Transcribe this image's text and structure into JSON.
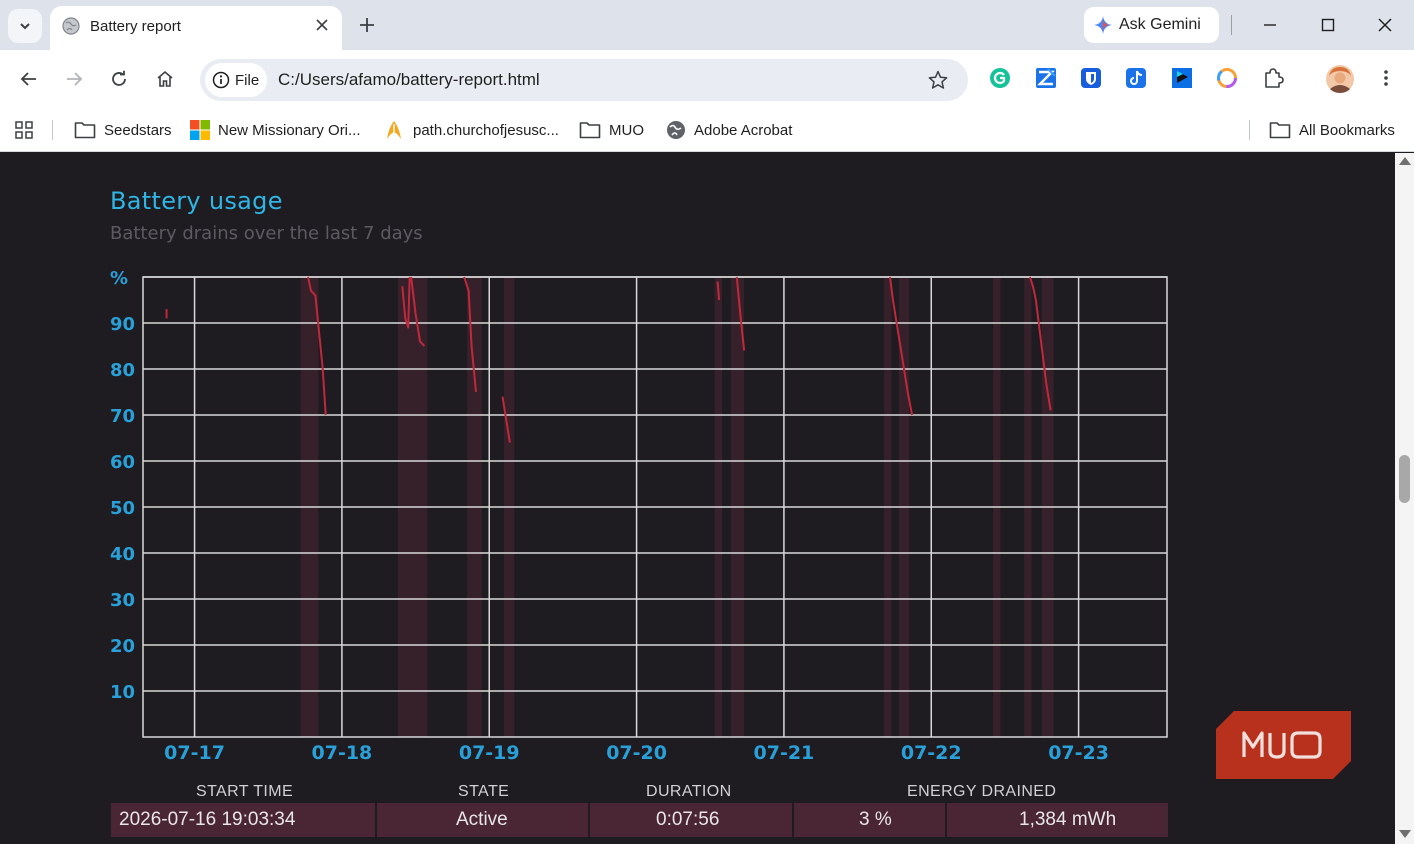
{
  "browser": {
    "tab": {
      "title": "Battery report",
      "favicon": "globe-icon"
    },
    "gemini_label": "Ask Gemini",
    "omnibox": {
      "chip_label": "File",
      "url": "C:/Users/afamo/battery-report.html"
    },
    "extensions": [
      "grammarly-icon",
      "zotero-icon",
      "bitwarden-icon",
      "tiktok-icon",
      "flag-extension-icon",
      "copilot-icon",
      "puzzle-icon"
    ],
    "bookmarks": [
      {
        "label": "Seedstars",
        "icon": "folder-icon"
      },
      {
        "label": "New Missionary Ori...",
        "icon": "windows-logo-icon"
      },
      {
        "label": "path.churchofjesusc...",
        "icon": "churchofjesus-icon"
      },
      {
        "label": "MUO",
        "icon": "folder-icon"
      },
      {
        "label": "Adobe Acrobat",
        "icon": "globe-icon"
      }
    ],
    "all_bookmarks_label": "All Bookmarks"
  },
  "report": {
    "title": "Battery usage",
    "subtitle": "Battery drains over the last 7 days",
    "table": {
      "headers": [
        "START TIME",
        "STATE",
        "DURATION",
        "ENERGY DRAINED"
      ],
      "rows": [
        {
          "start_time": "2026-07-16  19:03:34",
          "state": "Active",
          "duration": "0:07:56",
          "energy_percent": "3 %",
          "energy_mwh": "1,384 mWh"
        }
      ]
    }
  },
  "chart_data": {
    "type": "line",
    "title": "",
    "ylabel": "%",
    "yticks": [
      "90",
      "80",
      "70",
      "60",
      "50",
      "40",
      "30",
      "20",
      "10"
    ],
    "ylim": [
      0,
      100
    ],
    "xlim": [
      16.65,
      23.6
    ],
    "xticks": [
      "07-17",
      "07-18",
      "07-19",
      "07-20",
      "07-21",
      "07-22",
      "07-23"
    ],
    "xtick_values": [
      17,
      18,
      19,
      20,
      21,
      22,
      23
    ],
    "grid": true,
    "line_color": "#c1283c",
    "activity_color": "#4a2533",
    "series": [
      {
        "x": [
          16.81,
          16.81
        ],
        "y": [
          93,
          91
        ]
      },
      {
        "x": [
          17.77,
          17.79,
          17.82,
          17.87,
          17.89
        ],
        "y": [
          100,
          97,
          96,
          80,
          70
        ]
      },
      {
        "x": [
          18.41,
          18.43,
          18.45,
          18.46
        ],
        "y": [
          98,
          91,
          89,
          100
        ]
      },
      {
        "x": [
          18.47,
          18.5,
          18.53,
          18.56
        ],
        "y": [
          100,
          92,
          86,
          85
        ]
      },
      {
        "x": [
          18.83,
          18.86,
          18.88,
          18.91
        ],
        "y": [
          100,
          97,
          85,
          75
        ]
      },
      {
        "x": [
          19.09,
          19.11,
          19.14
        ],
        "y": [
          74,
          70,
          64
        ]
      },
      {
        "x": [
          20.55,
          20.56
        ],
        "y": [
          99,
          95
        ]
      },
      {
        "x": [
          20.68,
          20.71,
          20.73
        ],
        "y": [
          100,
          90,
          84
        ]
      },
      {
        "x": [
          21.72,
          21.74,
          21.84,
          21.87
        ],
        "y": [
          100,
          95,
          75,
          70
        ]
      },
      {
        "x": [
          22.67,
          22.69,
          22.71,
          22.78,
          22.81
        ],
        "y": [
          100,
          98,
          95,
          77,
          71
        ]
      }
    ],
    "activity_bands": [
      [
        17.72,
        17.84
      ],
      [
        18.38,
        18.58
      ],
      [
        18.85,
        18.95
      ],
      [
        19.1,
        19.17
      ],
      [
        20.53,
        20.58
      ],
      [
        20.64,
        20.73
      ],
      [
        21.68,
        21.73
      ],
      [
        21.78,
        21.85
      ],
      [
        22.42,
        22.47
      ],
      [
        22.63,
        22.68
      ],
      [
        22.75,
        22.83
      ]
    ]
  }
}
